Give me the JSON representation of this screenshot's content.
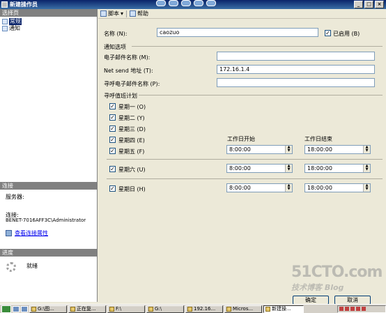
{
  "window": {
    "title": "新建操作员"
  },
  "toolbar": {
    "script_label": "脚本",
    "help_label": "帮助"
  },
  "left": {
    "select_page_header": "选择页",
    "pages": [
      {
        "label": "常规",
        "selected": true
      },
      {
        "label": "通知",
        "selected": false
      }
    ],
    "connection_header": "连接",
    "server_label": "服务器:",
    "server_value": "",
    "connection_label": "连接:",
    "connection_value": "BENET-7016AFF3C\\Administrator",
    "view_connection_link": "查看连接属性",
    "progress_header": "进度",
    "progress_status": "就绪"
  },
  "form": {
    "name_label": "名称 (N):",
    "name_value": "caozuo",
    "enabled_label": "已启用 (B)",
    "enabled": true,
    "notify_group": "通知选项",
    "email_label": "电子邮件名称 (M):",
    "email_value": "",
    "netsend_label": "Net send 地址 (T):",
    "netsend_value": "172.16.1.4",
    "pager_label": "寻呼电子邮件名称 (P):",
    "pager_value": "",
    "pager_schedule_group": "寻呼值班计划",
    "workday_start_header": "工作日开始",
    "workday_end_header": "工作日结束",
    "days": [
      {
        "label": "星期一 (O)",
        "checked": true
      },
      {
        "label": "星期二 (Y)",
        "checked": true
      },
      {
        "label": "星期三 (D)",
        "checked": true
      },
      {
        "label": "星期四 (E)",
        "checked": true
      },
      {
        "label": "星期五 (F)",
        "checked": true,
        "start": "8:00:00",
        "end": "18:00:00"
      },
      {
        "label": "星期六 (U)",
        "checked": true,
        "start": "8:00:00",
        "end": "18:00:00"
      },
      {
        "label": "星期日 (H)",
        "checked": true,
        "start": "8:00:00",
        "end": "18:00:00"
      }
    ]
  },
  "buttons": {
    "ok": "确定",
    "cancel": "取消"
  },
  "taskbar": {
    "tasks": [
      "G:\\图...",
      "正在复...",
      "F:\\",
      "G:\\",
      "192.16...",
      "Micros...",
      "新建操..."
    ]
  },
  "watermark": {
    "line1": "51CTO.com",
    "line2": "技术博客 Blog"
  }
}
